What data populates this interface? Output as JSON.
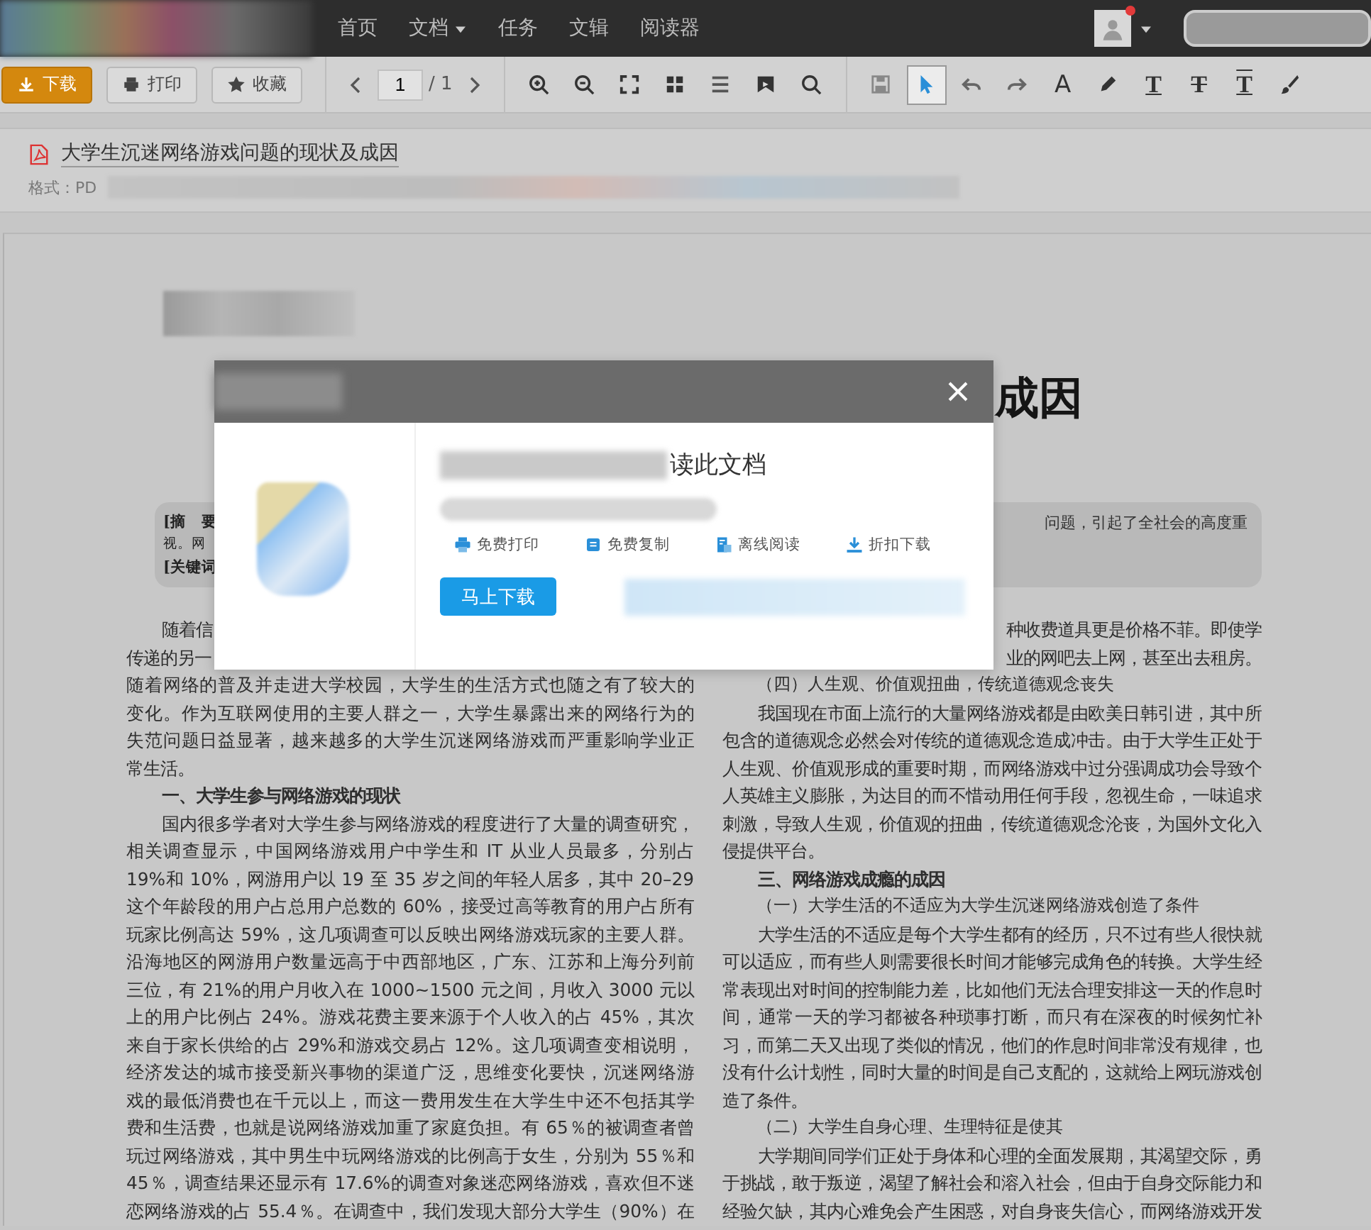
{
  "top_bar": {
    "nav": [
      {
        "label": "首页",
        "menu": false
      },
      {
        "label": "文档",
        "menu": true
      },
      {
        "label": "任务",
        "menu": false
      },
      {
        "label": "文辑",
        "menu": false
      },
      {
        "label": "阅读器",
        "menu": false
      }
    ],
    "avatar": {
      "badge": true
    }
  },
  "toolbar": {
    "buttons": [
      {
        "label": "下载",
        "kind": "primary"
      },
      {
        "label": "打印",
        "kind": "print"
      },
      {
        "label": "收藏",
        "kind": "star"
      }
    ],
    "pager": {
      "value": "1",
      "total": "/ 1"
    },
    "tools": [
      {
        "kind": "zoom-in",
        "selected": false
      },
      {
        "kind": "zoom-out",
        "selected": false
      },
      {
        "kind": "fit",
        "selected": false
      },
      {
        "kind": "grid",
        "selected": false
      },
      {
        "kind": "list",
        "selected": false
      },
      {
        "kind": "bookmark",
        "selected": false
      },
      {
        "kind": "search",
        "selected": false
      },
      {
        "kind": "divider"
      },
      {
        "kind": "save",
        "selected": false
      },
      {
        "kind": "pointer",
        "selected": true
      },
      {
        "kind": "undo",
        "selected": false
      },
      {
        "kind": "redo",
        "selected": false
      },
      {
        "kind": "glyph",
        "glyph": "A",
        "selected": false
      },
      {
        "kind": "pen",
        "selected": false
      },
      {
        "kind": "glyph-underline",
        "glyph": "T",
        "selected": false
      },
      {
        "kind": "glyph-strike",
        "glyph": "T",
        "selected": false
      },
      {
        "kind": "glyph-box",
        "glyph": "T",
        "selected": false
      },
      {
        "kind": "brush",
        "selected": false
      }
    ]
  },
  "document_header": {
    "title": "大学生沉迷网络游戏问题的现状及成因",
    "format": "格式：PD"
  },
  "page": {
    "title_fragment": "成因",
    "abstract": {
      "left_lines": [
        "[摘　要",
        "视。网",
        "[关键词"
      ],
      "right_line": "问题，引起了全社会的高度重"
    },
    "columns": [
      [
        {
          "kind": "fragment-start",
          "text": "随着信"
        },
        {
          "kind": "fragment",
          "text": "传递的另一"
        },
        {
          "kind": "line",
          "text": "随着网络的普及并走进大学校园，大学生的生活方式也随之有了较大的"
        },
        {
          "kind": "line",
          "text": "变化。作为互联网使用的主要人群之一，大学生暴露出来的网络行为的"
        },
        {
          "kind": "line",
          "text": "失范问题日益显著，越来越多的大学生沉迷网络游戏而严重影响学业正"
        },
        {
          "kind": "end",
          "text": "常生活。"
        },
        {
          "kind": "heading",
          "text": "一、大学生参与网络游戏的现状"
        },
        {
          "kind": "start",
          "text": "国内很多学者对大学生参与网络游戏的程度进行了大量的调查研究，"
        },
        {
          "kind": "line",
          "text": "相关调查显示，中国网络游戏用户中学生和 IT 从业人员最多，分别占"
        },
        {
          "kind": "line",
          "text": "19%和 10%，网游用户以 19 至 35 岁之间的年轻人居多，其中 20–29"
        },
        {
          "kind": "line",
          "text": "这个年龄段的用户占总用户总数的 60%，接受过高等教育的用户占所有"
        },
        {
          "kind": "line",
          "text": "玩家比例高达 59%，这几项调查可以反映出网络游戏玩家的主要人群。"
        },
        {
          "kind": "line",
          "text": "沿海地区的网游用户数量远高于中西部地区，广东、江苏和上海分列前"
        },
        {
          "kind": "line",
          "text": "三位，有 21%的用户月收入在 1000~1500 元之间，月收入 3000 元以"
        },
        {
          "kind": "line",
          "text": "上的用户比例占 24%。游戏花费主要来源于个人收入的占 45%，其次"
        },
        {
          "kind": "line",
          "text": "来自于家长供给的占 29%和游戏交易占 12%。这几项调查变相说明，"
        },
        {
          "kind": "line",
          "text": "经济发达的城市接受新兴事物的渠道广泛，思维变化要快，沉迷网络游"
        },
        {
          "kind": "line",
          "text": "戏的最低消费也在千元以上，而这一费用发生在大学生中还不包括其学"
        },
        {
          "kind": "line",
          "text": "费和生活费，也就是说网络游戏加重了家庭负担。有 65％的被调查者曾"
        },
        {
          "kind": "line",
          "text": "玩过网络游戏，其中男生中玩网络游戏的比例高于女生，分别为 55％和"
        },
        {
          "kind": "line",
          "text": "45％，调查结果还显示有 17.6%的调查对象迷恋网络游戏，喜欢但不迷"
        },
        {
          "kind": "line",
          "text": "恋网络游戏的占 55.4％。在调查中，我们发现大部分大学生（90%）在"
        }
      ],
      [
        {
          "kind": "tail",
          "text": "种收费道具更是价格不菲。即使学"
        },
        {
          "kind": "tail",
          "text": "业的网吧去上网，甚至出去租房。"
        },
        {
          "kind": "subheading",
          "text": "（四）人生观、价值观扭曲，传统道德观念丧失"
        },
        {
          "kind": "start",
          "text": "我国现在市面上流行的大量网络游戏都是由欧美日韩引进，其中所"
        },
        {
          "kind": "line",
          "text": "包含的道德观念必然会对传统的道德观念造成冲击。由于大学生正处于"
        },
        {
          "kind": "line",
          "text": "人生观、价值观形成的重要时期，而网络游戏中过分强调成功会导致个"
        },
        {
          "kind": "line",
          "text": "人英雄主义膨胀，为达目的而不惜动用任何手段，忽视生命，一味追求"
        },
        {
          "kind": "line",
          "text": "刺激，导致人生观，价值观的扭曲，传统道德观念沦丧，为国外文化入"
        },
        {
          "kind": "end",
          "text": "侵提供平台。"
        },
        {
          "kind": "heading",
          "text": "三、网络游戏成瘾的成因"
        },
        {
          "kind": "subheading",
          "text": "（一）大学生活的不适应为大学生沉迷网络游戏创造了条件"
        },
        {
          "kind": "start",
          "text": "大学生活的不适应是每个大学生都有的经历，只不过有些人很快就"
        },
        {
          "kind": "line",
          "text": "可以适应，而有些人则需要很长时间才能够完成角色的转换。大学生经"
        },
        {
          "kind": "line",
          "text": "常表现出对时间的控制能力差，比如他们无法合理安排这一天的作息时"
        },
        {
          "kind": "line",
          "text": "间，通常一天的学习都被各种琐事打断，而只有在深夜的时候匆忙补"
        },
        {
          "kind": "line",
          "text": "习，而第二天又出现了类似的情况，他们的作息时间非常没有规律，也"
        },
        {
          "kind": "line",
          "text": "没有什么计划性，同时大量的时间是自己支配的，这就给上网玩游戏创"
        },
        {
          "kind": "end",
          "text": "造了条件。"
        },
        {
          "kind": "subheading",
          "text": "（二）大学生自身心理、生理特征是使其"
        },
        {
          "kind": "start",
          "text": "大学期间同学们正处于身体和心理的全面发展期，其渴望交际，勇"
        },
        {
          "kind": "line",
          "text": "于挑战，敢于叛逆，渴望了解社会和溶入社会，但由于自身交际能力和"
        },
        {
          "kind": "line",
          "text": "经验欠缺，其内心难免会产生困惑，对自身丧失信心，而网络游戏开发"
        }
      ]
    ]
  },
  "dialog": {
    "title": "读此文档",
    "features": [
      {
        "label": "免费打印",
        "kind": "print"
      },
      {
        "label": "免费复制",
        "kind": "copy"
      },
      {
        "label": "离线阅读",
        "kind": "offline"
      },
      {
        "label": "折扣下载",
        "kind": "download"
      }
    ],
    "button": "马上下载"
  }
}
